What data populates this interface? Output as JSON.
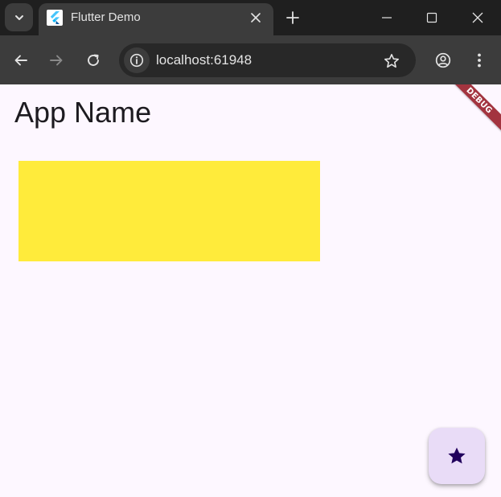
{
  "browser": {
    "tab": {
      "title": "Flutter Demo",
      "favicon": "flutter-logo-icon"
    },
    "address_bar": {
      "url": "localhost:61948"
    },
    "icons": {
      "tab_search": "chevron-down-icon",
      "new_tab": "plus-icon",
      "minimize": "minimize-icon",
      "maximize": "maximize-icon",
      "close": "close-icon",
      "back": "arrow-left-icon",
      "forward": "arrow-right-icon",
      "reload": "reload-icon",
      "site_info": "info-icon",
      "bookmark": "star-outline-icon",
      "profile": "account-circle-icon",
      "menu": "more-vert-icon"
    }
  },
  "app": {
    "title": "App Name",
    "debug_banner": "DEBUG",
    "fab_icon": "star-icon",
    "colors": {
      "background": "#fdf7ff",
      "box": "#ffeb3b",
      "fab": "#e9dcf7",
      "fab_icon": "#21005d",
      "debug_banner": "#a3343f"
    }
  }
}
